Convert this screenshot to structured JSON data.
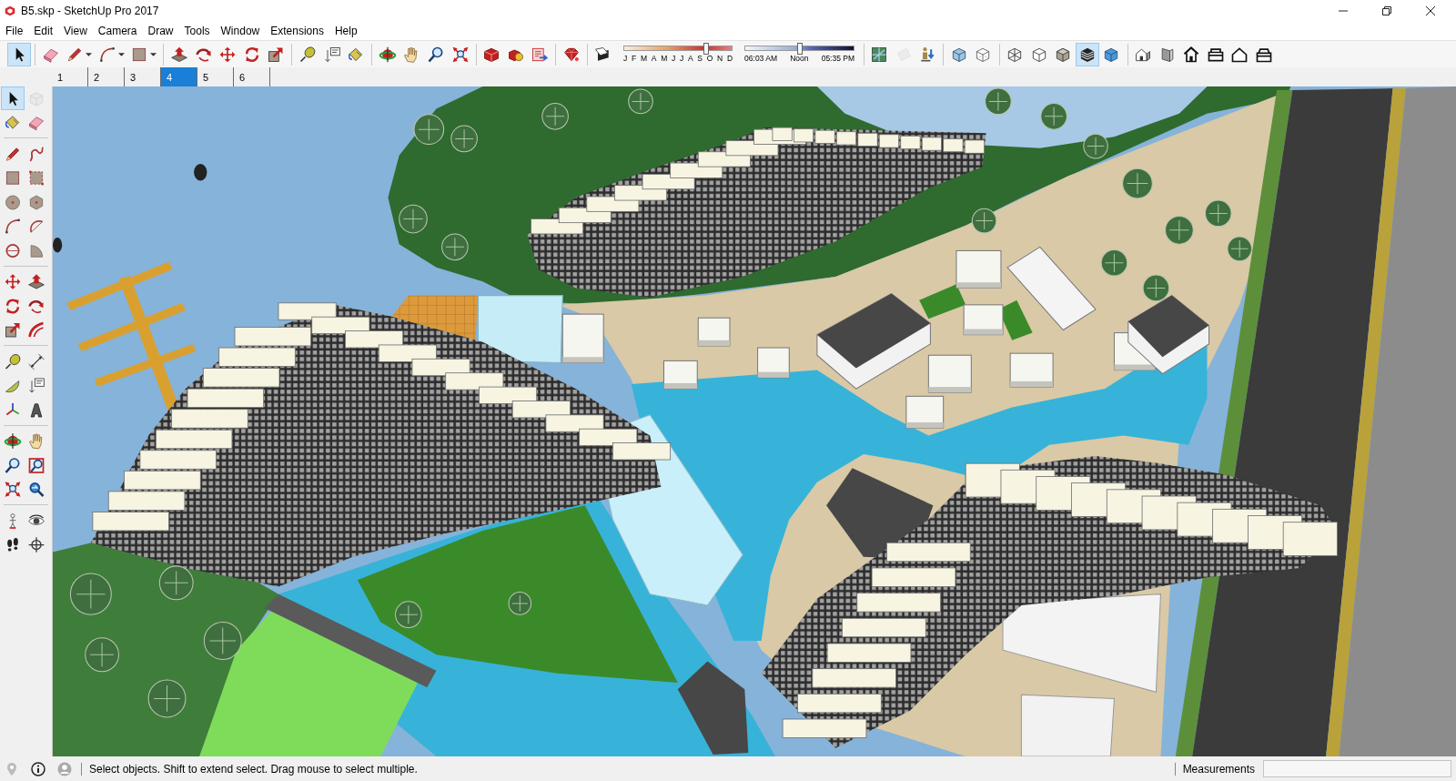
{
  "window": {
    "title": "B5.skp - SketchUp Pro 2017"
  },
  "menu": [
    "File",
    "Edit",
    "View",
    "Camera",
    "Draw",
    "Tools",
    "Window",
    "Extensions",
    "Help"
  ],
  "toolbar": {
    "groups": [
      {
        "kind": "tools",
        "tools": [
          {
            "kind": "select",
            "selected": true
          }
        ]
      },
      {
        "kind": "tools",
        "tools": [
          {
            "kind": "eraser",
            "selected": false,
            "dropdown": false
          },
          {
            "kind": "line",
            "selected": false,
            "dropdown": true
          },
          {
            "kind": "arc",
            "selected": false,
            "dropdown": true
          },
          {
            "kind": "rectangle",
            "selected": false,
            "dropdown": true
          }
        ]
      },
      {
        "kind": "tools",
        "tools": [
          {
            "kind": "pushpull",
            "selected": false
          },
          {
            "kind": "followme",
            "selected": false
          },
          {
            "kind": "move",
            "selected": false
          },
          {
            "kind": "rotate",
            "selected": false
          },
          {
            "kind": "scale",
            "selected": false
          }
        ]
      },
      {
        "kind": "tools",
        "tools": [
          {
            "kind": "tape",
            "selected": false
          },
          {
            "kind": "text",
            "selected": false
          },
          {
            "kind": "paint",
            "selected": false
          }
        ]
      },
      {
        "kind": "tools",
        "tools": [
          {
            "kind": "orbit",
            "selected": false
          },
          {
            "kind": "pan",
            "selected": false
          },
          {
            "kind": "zoom",
            "selected": false
          },
          {
            "kind": "zoomextents",
            "selected": false
          }
        ]
      },
      {
        "kind": "tools",
        "tools": [
          {
            "kind": "warehouse",
            "selected": false
          },
          {
            "kind": "components",
            "selected": false
          },
          {
            "kind": "extension",
            "selected": false
          }
        ]
      },
      {
        "kind": "tools",
        "tools": [
          {
            "kind": "ruby",
            "selected": false
          }
        ]
      },
      {
        "kind": "shadow",
        "tools": [
          {
            "kind": "shadows",
            "selected": false
          }
        ],
        "month_slider": {
          "labels": [
            "J",
            "F",
            "M",
            "A",
            "M",
            "J",
            "J",
            "A",
            "S",
            "O",
            "N",
            "D"
          ],
          "level": 0.76
        },
        "time_slider": {
          "labels": [
            "06:03 AM",
            "Noon",
            "05:35 PM"
          ],
          "level": 0.5
        }
      },
      {
        "kind": "tools",
        "tools": [
          {
            "kind": "map",
            "selected": false,
            "disabled": false
          },
          {
            "kind": "location",
            "selected": false,
            "disabled": true
          },
          {
            "kind": "photo",
            "selected": false,
            "disabled": false
          }
        ]
      },
      {
        "kind": "tools",
        "tools": [
          {
            "kind": "xray",
            "selected": false
          },
          {
            "kind": "backedges",
            "selected": false
          }
        ]
      },
      {
        "kind": "tools",
        "tools": [
          {
            "kind": "wireframe",
            "selected": false
          },
          {
            "kind": "hiddenline",
            "selected": false
          },
          {
            "kind": "shaded",
            "selected": false
          },
          {
            "kind": "textured",
            "selected": true
          },
          {
            "kind": "mono",
            "selected": false
          }
        ]
      },
      {
        "kind": "tools",
        "tools": [
          {
            "kind": "iso",
            "selected": false
          },
          {
            "kind": "top",
            "selected": false
          },
          {
            "kind": "front",
            "selected": false
          },
          {
            "kind": "right",
            "selected": false
          },
          {
            "kind": "back",
            "selected": false
          },
          {
            "kind": "left",
            "selected": false
          }
        ]
      }
    ]
  },
  "scene_tabs": [
    {
      "label": "1",
      "selected": false
    },
    {
      "label": "2",
      "selected": false
    },
    {
      "label": "3",
      "selected": false
    },
    {
      "label": "4",
      "selected": true
    },
    {
      "label": "5",
      "selected": false
    },
    {
      "label": "6",
      "selected": false
    }
  ],
  "tool_palette": {
    "groups": [
      {
        "tools": [
          {
            "kind": "select",
            "selected": true,
            "disabled": false
          },
          {
            "kind": "component",
            "selected": false,
            "disabled": true
          },
          {
            "kind": "paint",
            "selected": false,
            "disabled": false
          },
          {
            "kind": "eraser",
            "selected": false,
            "disabled": false
          }
        ]
      },
      {
        "tools": [
          {
            "kind": "line",
            "selected": false
          },
          {
            "kind": "freehand",
            "selected": false
          },
          {
            "kind": "rectangle",
            "selected": false
          },
          {
            "kind": "rotrect",
            "selected": false
          },
          {
            "kind": "circle",
            "selected": false
          },
          {
            "kind": "polygon",
            "selected": false
          },
          {
            "kind": "arc",
            "selected": false
          },
          {
            "kind": "arc2",
            "selected": false
          },
          {
            "kind": "arc3",
            "selected": false
          },
          {
            "kind": "pie",
            "selected": false
          }
        ]
      },
      {
        "tools": [
          {
            "kind": "move",
            "selected": false
          },
          {
            "kind": "pushpull",
            "selected": false
          },
          {
            "kind": "rotate",
            "selected": false
          },
          {
            "kind": "followme",
            "selected": false
          },
          {
            "kind": "scale",
            "selected": false
          },
          {
            "kind": "offset",
            "selected": false
          }
        ]
      },
      {
        "tools": [
          {
            "kind": "tape",
            "selected": false
          },
          {
            "kind": "dimension",
            "selected": false
          },
          {
            "kind": "protractor",
            "selected": false
          },
          {
            "kind": "text",
            "selected": false
          },
          {
            "kind": "axes",
            "selected": false
          },
          {
            "kind": "text3d",
            "selected": false
          }
        ]
      },
      {
        "tools": [
          {
            "kind": "orbit",
            "selected": false
          },
          {
            "kind": "pan",
            "selected": false
          },
          {
            "kind": "zoom",
            "selected": false
          },
          {
            "kind": "zoomwindow",
            "selected": false
          },
          {
            "kind": "zoomextents",
            "selected": false
          },
          {
            "kind": "previous",
            "selected": false
          }
        ]
      },
      {
        "tools": [
          {
            "kind": "camera",
            "selected": false
          },
          {
            "kind": "lookaround",
            "selected": false
          },
          {
            "kind": "walk",
            "selected": false
          },
          {
            "kind": "section",
            "selected": false
          }
        ]
      }
    ]
  },
  "status_bar": {
    "message": "Select objects. Shift to extend select. Drag mouse to select multiple.",
    "measurements_label": "Measurements"
  }
}
